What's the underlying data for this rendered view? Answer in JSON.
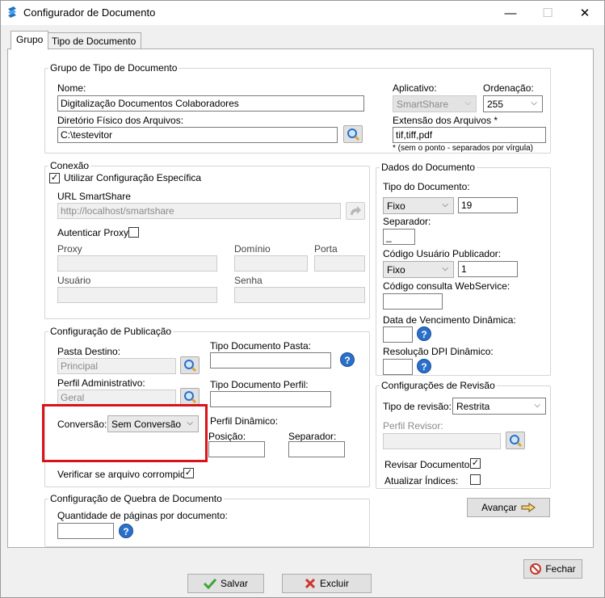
{
  "window": {
    "title": "Configurador de Documento",
    "minimize": "—",
    "maximize": "☐",
    "close": "✕"
  },
  "tabs": [
    {
      "label": "Grupo"
    },
    {
      "label": "Tipo de Documento"
    }
  ],
  "grupo_tipo": {
    "legend": "Grupo de Tipo de Documento",
    "nome_label": "Nome:",
    "nome_value": "Digitalização Documentos Colaboradores",
    "diretorio_label": "Diretório Físico dos Arquivos:",
    "diretorio_value": "C:\\testevitor",
    "aplicativo_label": "Aplicativo:",
    "aplicativo_value": "SmartShare",
    "ordenacao_label": "Ordenação:",
    "ordenacao_value": "255",
    "extensao_label": "Extensão dos Arquivos *",
    "extensao_value": "tif,tiff,pdf",
    "extensao_note": "* (sem o ponto - separados por vírgula)"
  },
  "conexao": {
    "legend": "Conexão",
    "utilizar_label": "Utilizar Configuração Específica",
    "utilizar_checked": "✓",
    "url_label": "URL SmartShare",
    "url_value": "http://localhost/smartshare",
    "autenticar_label": "Autenticar Proxy:",
    "proxy_label": "Proxy",
    "dominio_label": "Domínio",
    "porta_label": "Porta",
    "usuario_label": "Usuário",
    "senha_label": "Senha"
  },
  "publicacao": {
    "legend": "Configuração de Publicação",
    "pasta_label": "Pasta Destino:",
    "pasta_value": "Principal",
    "perfil_label": "Perfil Administrativo:",
    "perfil_value": "Geral",
    "conversao_label": "Conversão:",
    "conversao_value": "Sem Conversão",
    "verificar_label": "Verificar se arquivo corrompido:",
    "verificar_checked": "✓",
    "tipo_pasta_label": "Tipo Documento Pasta:",
    "tipo_perfil_label": "Tipo Documento Perfil:",
    "perfil_dinamico_label": "Perfil Dinâmico:",
    "posicao_label": "Posição:",
    "separador_label": "Separador:"
  },
  "quebra": {
    "legend": "Configuração de Quebra de Documento",
    "quantidade_label": "Quantidade de páginas por documento:"
  },
  "dados": {
    "legend": "Dados do Documento",
    "tipo_label": "Tipo do Documento:",
    "tipo_select": "Fixo",
    "tipo_value": "19",
    "separador_label": "Separador:",
    "separador_value": "_",
    "codigo_label": "Código Usuário Publicador:",
    "codigo_select": "Fixo",
    "codigo_value": "1",
    "ws_label": "Código consulta WebService:",
    "vencimento_label": "Data de Vencimento Dinâmica:",
    "dpi_label": "Resolução DPI Dinâmico:"
  },
  "revisao": {
    "legend": "Configurações de Revisão",
    "tipo_label": "Tipo de revisão:",
    "tipo_value": "Restrita",
    "perfil_label": "Perfil Revisor:",
    "revisar_label": "Revisar Documento:",
    "revisar_checked": "✓",
    "atualizar_label": "Atualizar Índices:"
  },
  "buttons": {
    "avancar": "Avançar",
    "fechar": "Fechar",
    "salvar": "Salvar",
    "excluir": "Excluir"
  },
  "help_glyph": "?"
}
